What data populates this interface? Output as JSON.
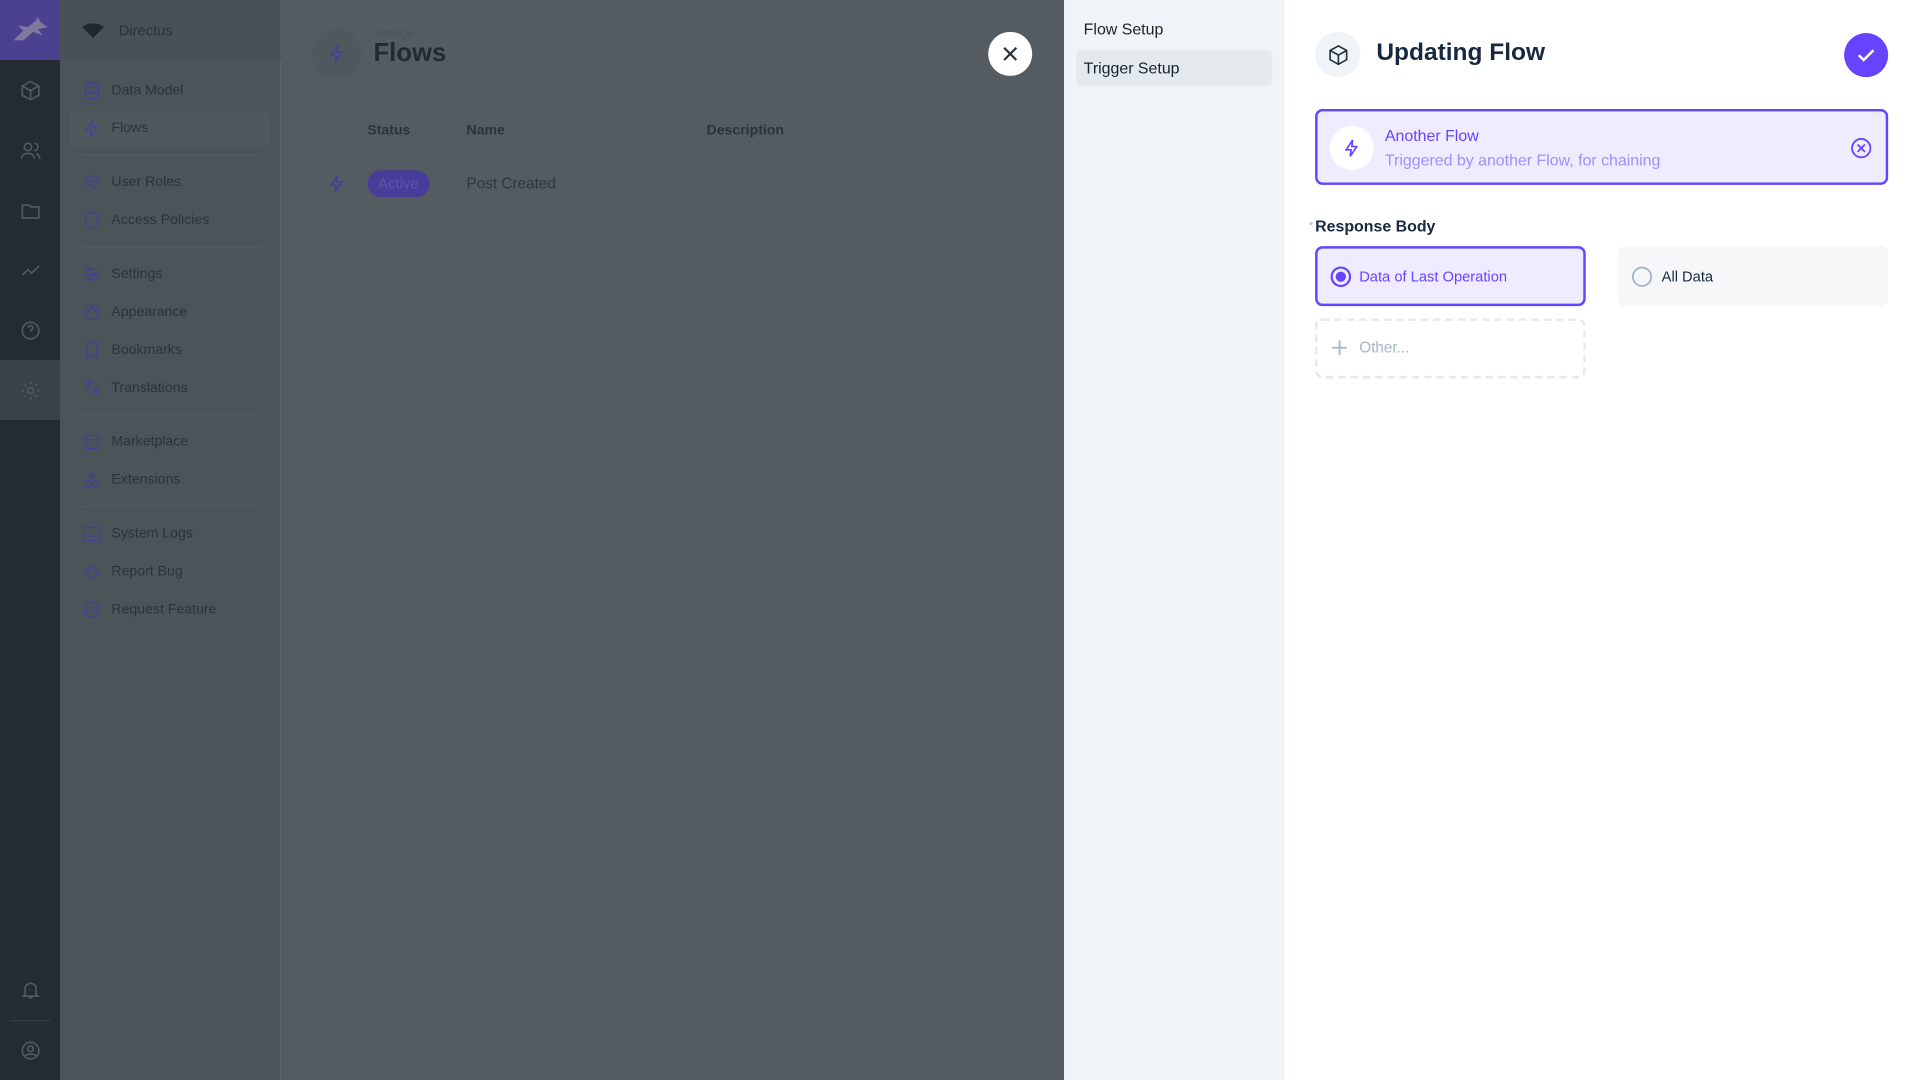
{
  "project": {
    "name": "Directus"
  },
  "nav": {
    "items": [
      {
        "label": "Data Model",
        "icon": "database-icon"
      },
      {
        "label": "Flows",
        "icon": "bolt-icon"
      },
      {
        "label": "User Roles",
        "icon": "users-icon"
      },
      {
        "label": "Access Policies",
        "icon": "shield-icon"
      },
      {
        "label": "Settings",
        "icon": "sliders-icon"
      },
      {
        "label": "Appearance",
        "icon": "palette-icon"
      },
      {
        "label": "Bookmarks",
        "icon": "bookmark-icon"
      },
      {
        "label": "Translations",
        "icon": "translate-icon"
      },
      {
        "label": "Marketplace",
        "icon": "store-icon"
      },
      {
        "label": "Extensions",
        "icon": "extensions-icon"
      },
      {
        "label": "System Logs",
        "icon": "terminal-icon"
      },
      {
        "label": "Report Bug",
        "icon": "bug-icon"
      },
      {
        "label": "Request Feature",
        "icon": "check-circle-icon"
      }
    ]
  },
  "header": {
    "breadcrumb": "Settings",
    "title": "Flows"
  },
  "table": {
    "columns": [
      "Status",
      "Name",
      "Description"
    ],
    "rows": [
      {
        "status": "Active",
        "name": "Post Created",
        "description": ""
      }
    ]
  },
  "drawer": {
    "tabs": [
      "Flow Setup",
      "Trigger Setup"
    ],
    "title": "Updating Flow",
    "trigger": {
      "title": "Another Flow",
      "subtitle": "Triggered by another Flow, for chaining"
    },
    "field_label": "Response Body",
    "options": [
      {
        "label": "Data of Last Operation",
        "selected": true
      },
      {
        "label": "All Data",
        "selected": false
      }
    ],
    "other_placeholder": "Other..."
  },
  "colors": {
    "accent": "#6644ff",
    "accent_bg": "#f0ecff"
  }
}
